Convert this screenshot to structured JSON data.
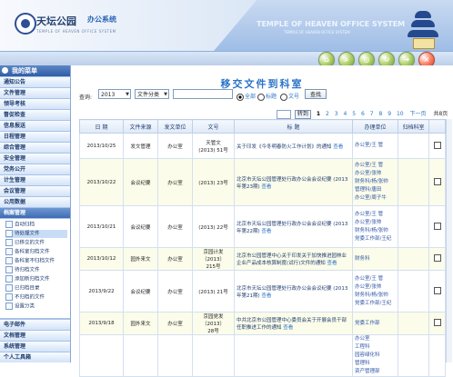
{
  "header": {
    "brand_cn": "天坛公园",
    "brand_tag": "办公系统",
    "brand_sub": "TEMPLE OF HEAVEN OFFICE SYSTEM",
    "temple_en": "TEMPLE OF HEAVEN OFFICE SYSTEM",
    "temple_sub": "TEMPLE OF HEAVEN OFFICE SYSTEM"
  },
  "toolbar_icons": [
    "home-icon",
    "search-icon",
    "zoom-icon",
    "refresh-icon",
    "forward-icon",
    "close-icon"
  ],
  "sidebar": {
    "title": "我的菜单",
    "groups": [
      {
        "label": "通知公告"
      },
      {
        "label": "文件管理"
      },
      {
        "label": "领导考核"
      },
      {
        "label": "督促检查"
      },
      {
        "label": "信息报送"
      },
      {
        "label": "日程管理"
      },
      {
        "label": "综合管理"
      },
      {
        "label": "安全管理"
      },
      {
        "label": "党务公开"
      },
      {
        "label": "计生管理"
      },
      {
        "label": "会议管理"
      },
      {
        "label": "公用数据"
      },
      {
        "label": "档案管理"
      }
    ],
    "submenu": [
      {
        "label": "自动归档"
      },
      {
        "label": "待处理文件"
      },
      {
        "label": "已移交的文件"
      },
      {
        "label": "各科室归档文件"
      },
      {
        "label": "各科室不归档文件"
      },
      {
        "label": "待归档文件"
      },
      {
        "label": "添加新归档文件"
      },
      {
        "label": "已归档目录"
      },
      {
        "label": "不归档的文件"
      },
      {
        "label": "设置分类"
      }
    ],
    "bottom_groups": [
      {
        "label": "电子邮件"
      },
      {
        "label": "文档管理"
      },
      {
        "label": "系统管理"
      },
      {
        "label": "个人工具箱"
      }
    ]
  },
  "main": {
    "title": "移交文件到科室",
    "search_label": "查询:",
    "year_value": "2013",
    "type_value": "文件分类",
    "keyword_value": "",
    "radio_all": "全部",
    "radio_title": "标题",
    "radio_number": "文号",
    "search_button": "查找",
    "pager": {
      "go_label": "转到",
      "pages": [
        "1",
        "2",
        "3",
        "4",
        "5",
        "6",
        "7",
        "8",
        "9",
        "10"
      ],
      "next_label": "下一页",
      "total_text": "共8页(150条)"
    },
    "table": {
      "headers": [
        "日 期",
        "文件来源",
        "发文单位",
        "文号",
        "标 题",
        "办理单位",
        "归档科室",
        ""
      ],
      "rows": [
        {
          "date": "2013/10/25",
          "source": "发文管理",
          "unit": "办公室",
          "number": "天管文\n(2013) 51号",
          "title": "关于印发《今冬明春防火工作计划》的通知 ",
          "title_link": "查看",
          "handler": "办公室/王 管",
          "archive": ""
        },
        {
          "date": "2013/10/22",
          "source": "会议纪要",
          "unit": "办公室",
          "number": "(2013) 23号",
          "title": "北京市天坛公园管理处行政办公会会议纪要 (2013年第23期) ",
          "title_link": "查看",
          "handler": "办公室/王 管\n办公室/张帅\n财务科/杨/张帅\n管理科/唐田\n办公室/周子牛",
          "archive": ""
        },
        {
          "date": "2013/10/21",
          "source": "会议纪要",
          "unit": "办公室",
          "number": "(2013) 22号",
          "title": "北京市天坛公园管理处行政办公会会议纪要 (2013年第22期) ",
          "title_link": "查看",
          "handler": "办公室/王 管\n办公室/张帅\n财务科/杨/张帅\n党委工作部/王纪",
          "archive": ""
        },
        {
          "date": "2013/10/12",
          "source": "园外来文",
          "unit": "办公室",
          "number": "京园计发〔2013〕\n215号",
          "title": "北京市公园管理中心关于印发关于加快推进园林业企业产品成本核算制度(试行)文件的通知 ",
          "title_link": "查看",
          "handler": "财务科",
          "archive": ""
        },
        {
          "date": "2013/9/22",
          "source": "会议纪要",
          "unit": "办公室",
          "number": "(2013) 21号",
          "title": "北京市天坛公园管理处行政办公会会议纪要 (2013年第21期) ",
          "title_link": "查看",
          "handler": "办公室/王 管\n办公室/张帅\n财务科/杨/张帅\n党委工作部/王纪",
          "archive": ""
        },
        {
          "date": "2013/9/18",
          "source": "园外来文",
          "unit": "办公室",
          "number": "京园党发〔2013〕\n28号",
          "title": "中共北京市公园管理中心委员会关于开展会员干部任职推进工作的通知 ",
          "title_link": "查看",
          "handler": "党委工作部",
          "archive": ""
        },
        {
          "date": "",
          "source": "",
          "unit": "",
          "number": "",
          "title": "",
          "title_link": "",
          "handler": "办公室\n工程科\n园容绿化科\n管理科\n资产管理部",
          "archive": ""
        }
      ]
    }
  }
}
